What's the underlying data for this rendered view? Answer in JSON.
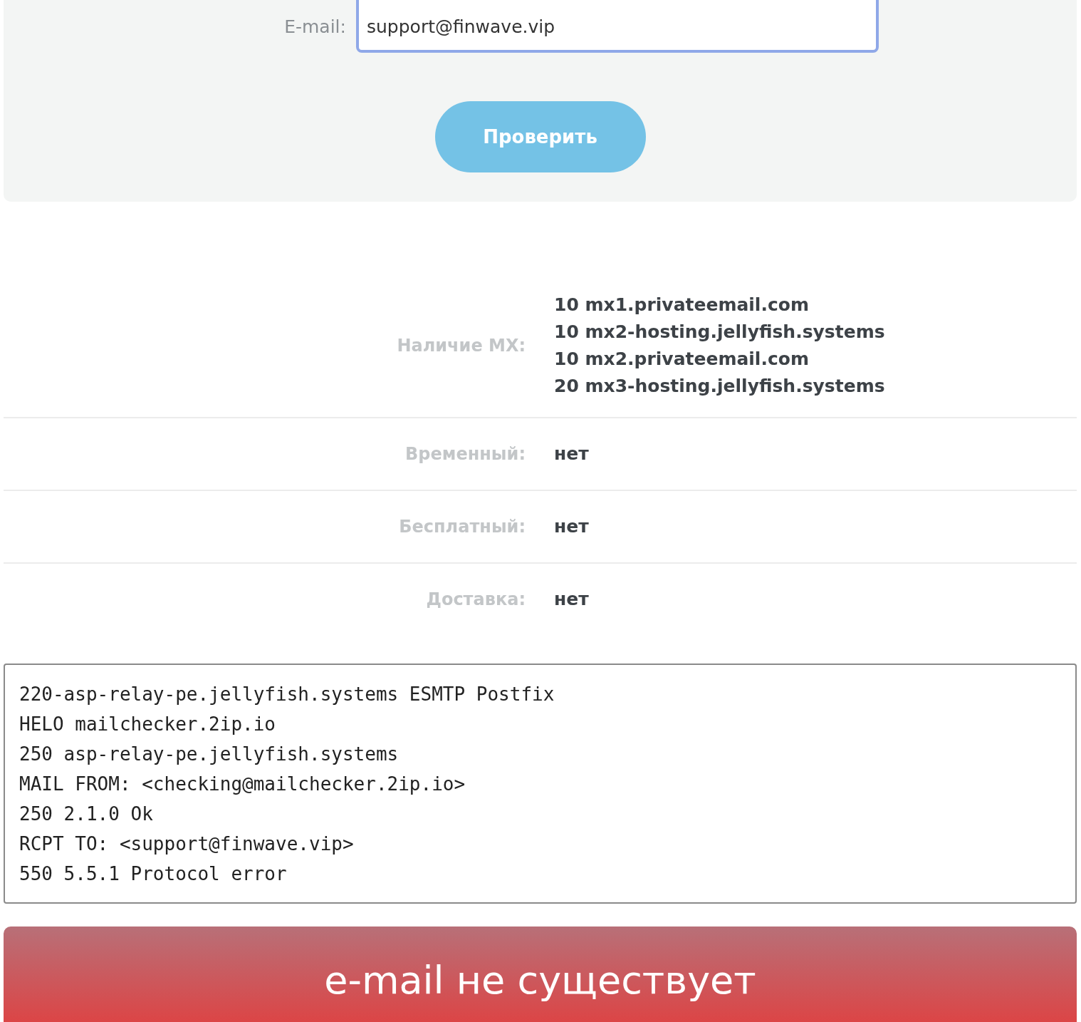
{
  "form": {
    "email_label": "E-mail:",
    "email_value": "support@finwave.vip",
    "check_button": "Проверить"
  },
  "results": [
    {
      "label": "Наличие MX:",
      "values": [
        "10 mx1.privateemail.com",
        "10 mx2-hosting.jellyfish.systems",
        "10 mx2.privateemail.com",
        "20 mx3-hosting.jellyfish.systems"
      ]
    },
    {
      "label": "Временный:",
      "values": [
        "нет"
      ]
    },
    {
      "label": "Бесплатный:",
      "values": [
        "нет"
      ]
    },
    {
      "label": "Доставка:",
      "values": [
        "нет"
      ]
    }
  ],
  "smtp_log": [
    "220-asp-relay-pe.jellyfish.systems ESMTP Postfix",
    "HELO mailchecker.2ip.io",
    "250 asp-relay-pe.jellyfish.systems",
    "MAIL FROM: <checking@mailchecker.2ip.io>",
    "250 2.1.0 Ok",
    "RCPT TO: <support@finwave.vip>",
    "550 5.5.1 Protocol error"
  ],
  "verdict": {
    "kind": "error",
    "text": "e-mail не существует"
  }
}
